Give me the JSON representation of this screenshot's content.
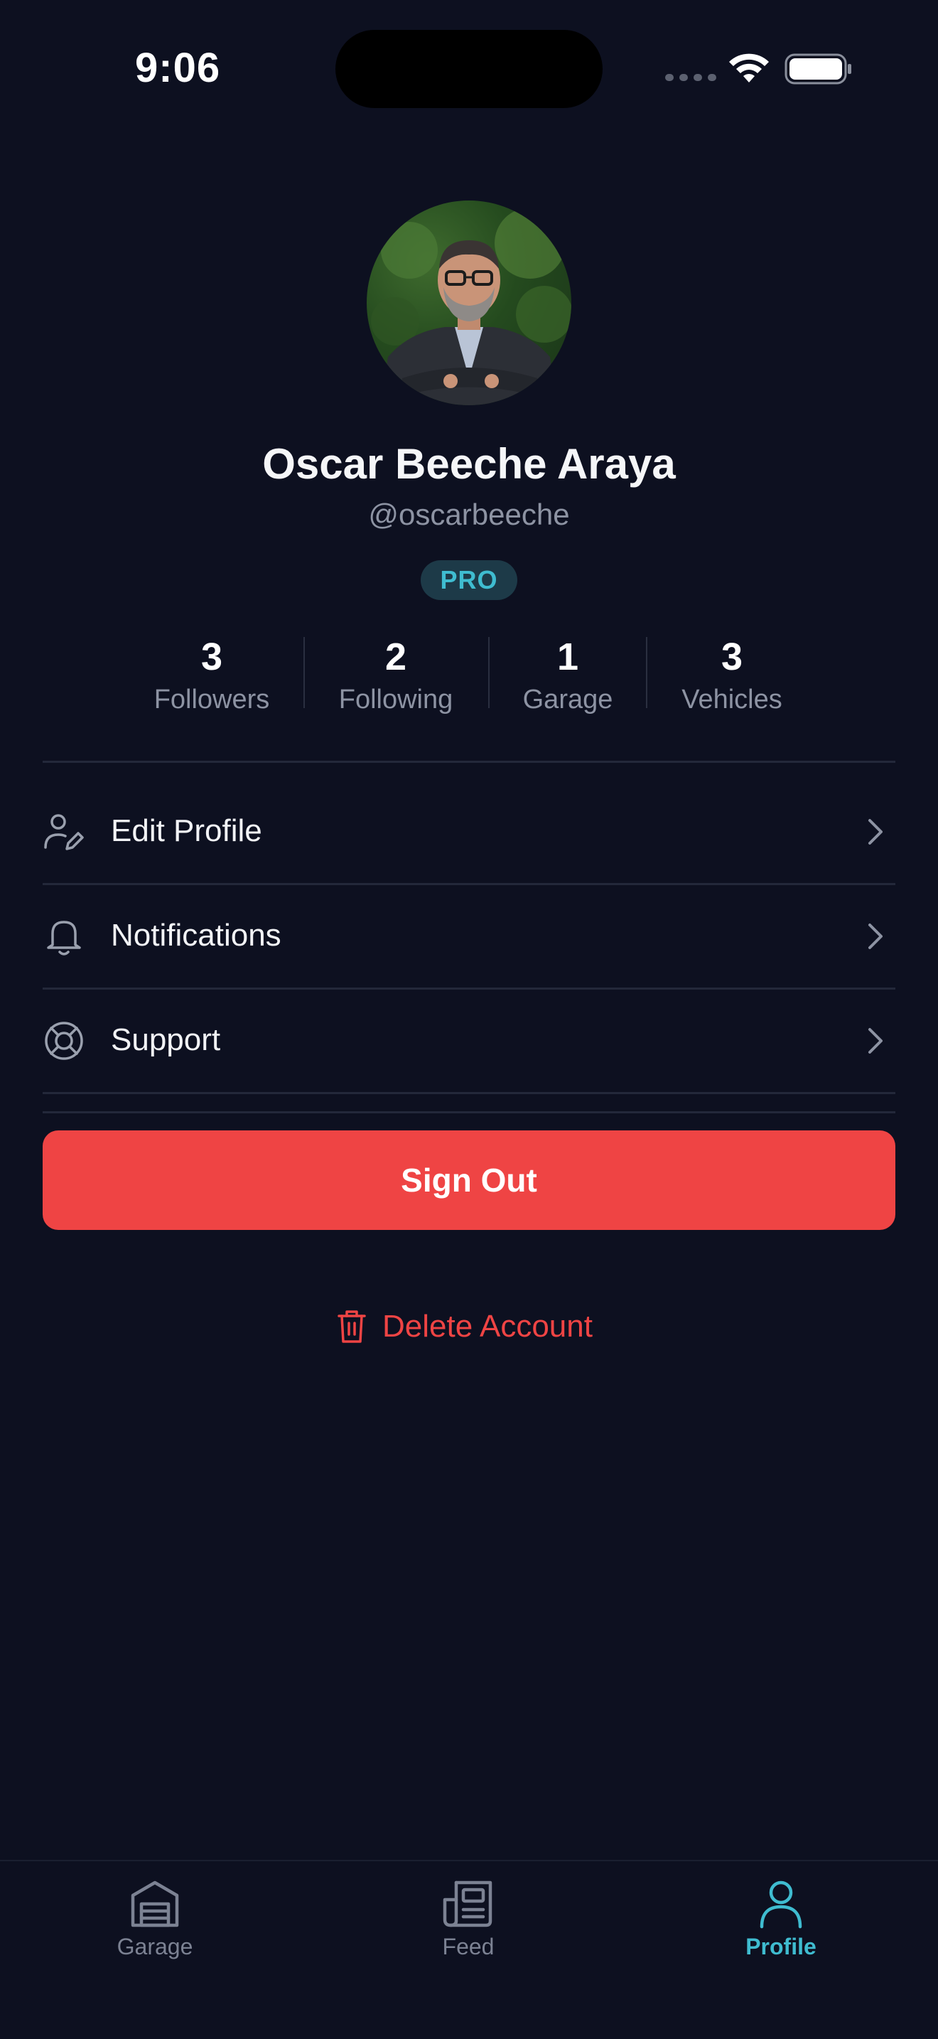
{
  "status_bar": {
    "time": "9:06"
  },
  "profile": {
    "name": "Oscar Beeche Araya",
    "handle": "@oscarbeeche",
    "badge": "PRO",
    "stats": [
      {
        "value": "3",
        "label": "Followers"
      },
      {
        "value": "2",
        "label": "Following"
      },
      {
        "value": "1",
        "label": "Garage"
      },
      {
        "value": "3",
        "label": "Vehicles"
      }
    ]
  },
  "menu": [
    {
      "label": "Edit Profile",
      "icon": "user-edit-icon"
    },
    {
      "label": "Notifications",
      "icon": "bell-icon"
    },
    {
      "label": "Support",
      "icon": "lifebuoy-icon"
    }
  ],
  "actions": {
    "sign_out": "Sign Out",
    "delete_account": "Delete Account"
  },
  "tabbar": {
    "tabs": [
      {
        "label": "Garage",
        "icon": "garage-icon",
        "active": false
      },
      {
        "label": "Feed",
        "icon": "newspaper-icon",
        "active": false
      },
      {
        "label": "Profile",
        "icon": "user-icon",
        "active": true
      }
    ]
  },
  "colors": {
    "background": "#0d1020",
    "accent": "#3fbcd0",
    "danger": "#ef4444",
    "muted": "#8d93a3"
  }
}
